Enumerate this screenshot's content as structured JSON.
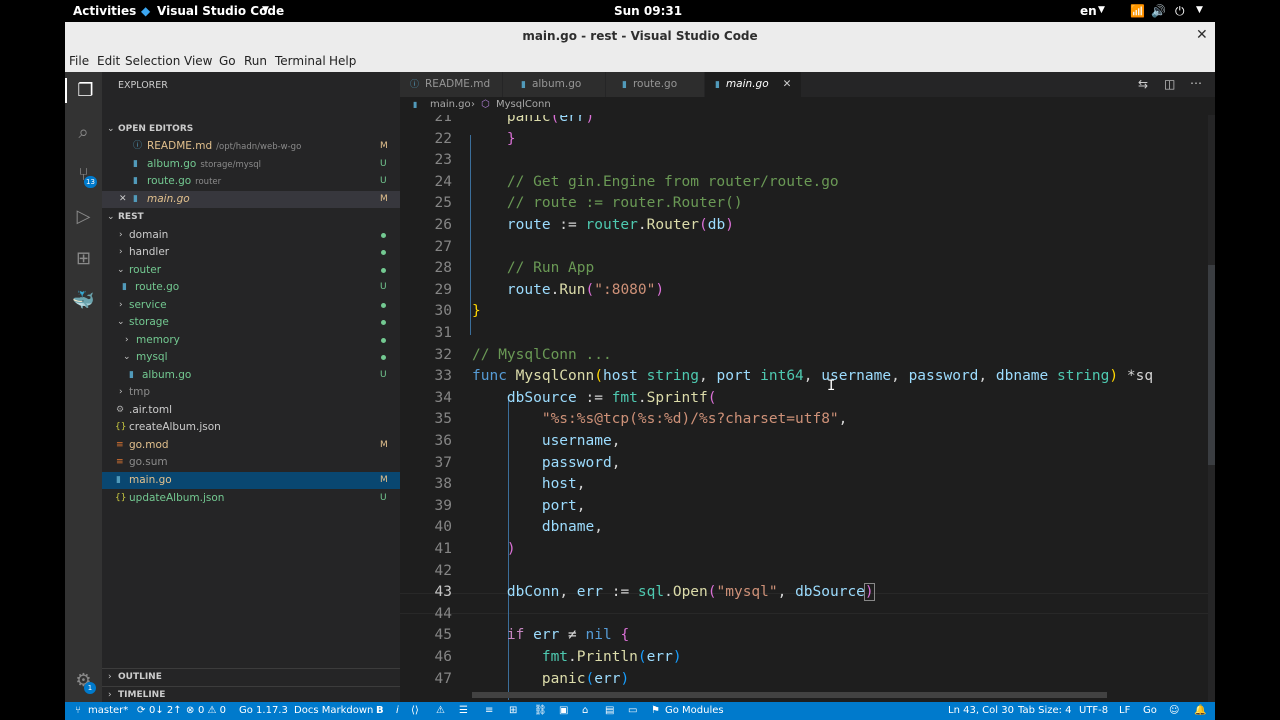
{
  "topbar": {
    "activities": "Activities",
    "app": "Visual Studio Code",
    "clock": "Sun 09:31",
    "lang": "en"
  },
  "window": {
    "title": "main.go - rest - Visual Studio Code"
  },
  "menu": [
    "File",
    "Edit",
    "Selection",
    "View",
    "Go",
    "Run",
    "Terminal",
    "Help"
  ],
  "activity": {
    "scm_badge": "13",
    "accounts_badge": "1"
  },
  "sidebar": {
    "explorer_title": "EXPLORER",
    "open_editors_title": "OPEN EDITORS",
    "open_editors": [
      {
        "name": "README.md",
        "desc": "/opt/hadn/web-w-go",
        "status": "M"
      },
      {
        "name": "album.go",
        "desc": "storage/mysql",
        "status": "U"
      },
      {
        "name": "route.go",
        "desc": "router",
        "status": "U"
      },
      {
        "name": "main.go",
        "desc": "",
        "status": "M"
      }
    ],
    "project_title": "REST",
    "tree": [
      {
        "name": "domain",
        "status": "dot"
      },
      {
        "name": "handler",
        "status": "dot"
      },
      {
        "name": "router",
        "status": "dot"
      },
      {
        "name": "route.go",
        "status": "U"
      },
      {
        "name": "service",
        "status": "dot"
      },
      {
        "name": "storage",
        "status": "dot"
      },
      {
        "name": "memory",
        "status": "dot"
      },
      {
        "name": "mysql",
        "status": "dot"
      },
      {
        "name": "album.go",
        "status": "U"
      },
      {
        "name": "tmp",
        "status": ""
      },
      {
        "name": ".air.toml",
        "status": ""
      },
      {
        "name": "createAlbum.json",
        "status": ""
      },
      {
        "name": "go.mod",
        "status": "M"
      },
      {
        "name": "go.sum",
        "status": ""
      },
      {
        "name": "main.go",
        "status": "M"
      },
      {
        "name": "updateAlbum.json",
        "status": "U"
      }
    ],
    "outline": "OUTLINE",
    "timeline": "TIMELINE"
  },
  "tabs": [
    "README.md",
    "album.go",
    "route.go",
    "main.go"
  ],
  "breadcrumb": {
    "file": "main.go",
    "symbol": "MysqlConn"
  },
  "editor": {
    "lines": [
      "21",
      "22",
      "23",
      "24",
      "25",
      "26",
      "27",
      "28",
      "29",
      "30",
      "31",
      "32",
      "33",
      "34",
      "35",
      "36",
      "37",
      "38",
      "39",
      "40",
      "41",
      "42",
      "43",
      "44",
      "45",
      "46",
      "47"
    ]
  },
  "status": {
    "branch": "master*",
    "sync": "0↓ 2↑",
    "problems": "0 ⚠ 0",
    "go": "Go 1.17.3",
    "docs": "Docs Markdown",
    "position": "Ln 43, Col 30",
    "tabsize": "Tab Size: 4",
    "encoding": "UTF-8",
    "eol": "LF",
    "lang": "Go",
    "modules": "Go Modules"
  }
}
